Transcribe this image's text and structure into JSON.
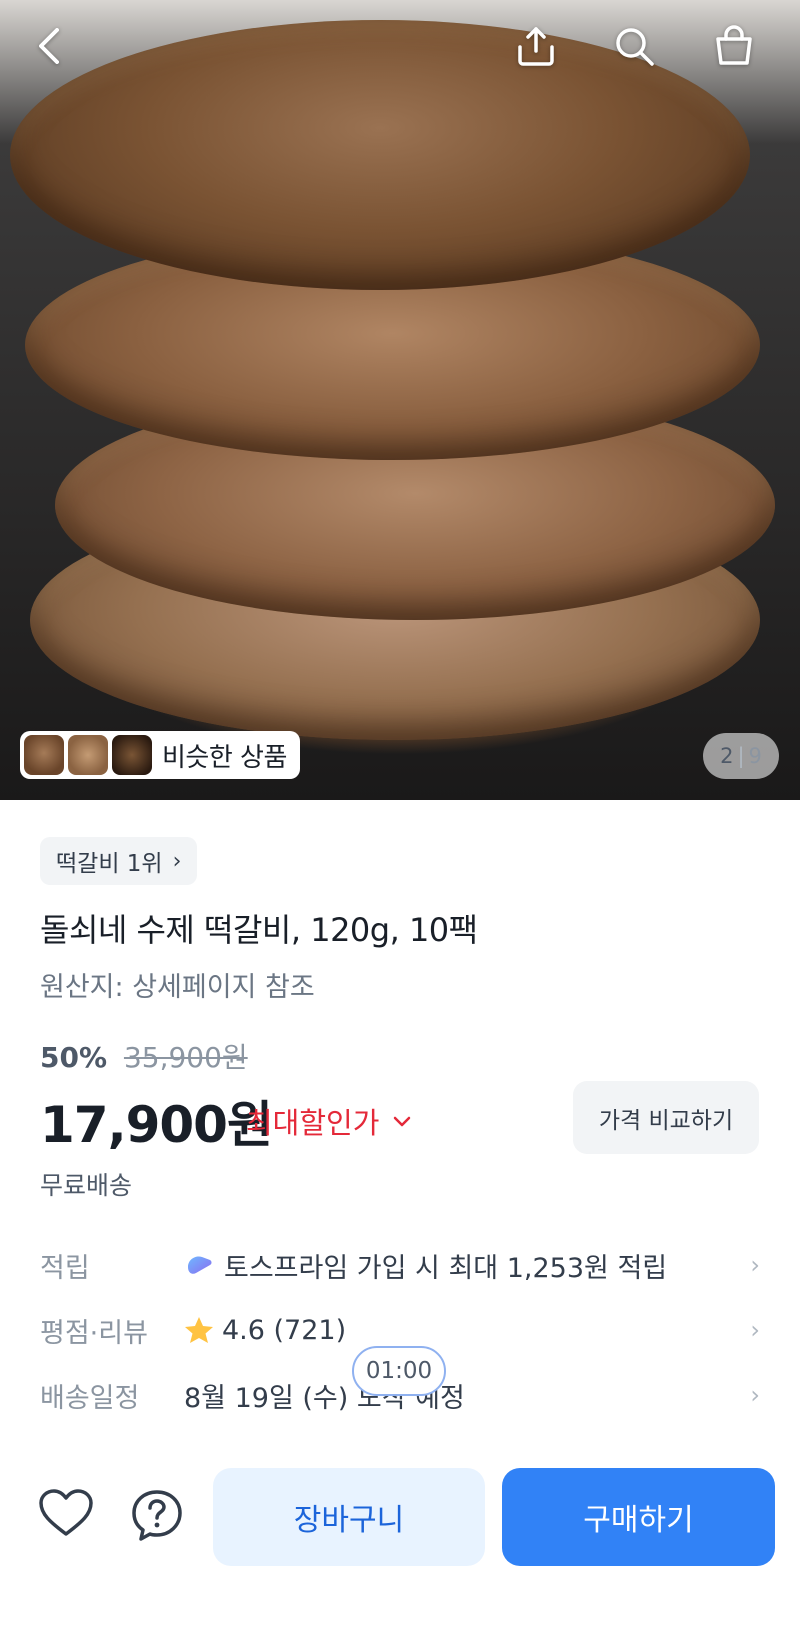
{
  "hero": {
    "counter_current": "2",
    "counter_separator": "|",
    "counter_total": "9",
    "similar_label": "비슷한 상품"
  },
  "topbar": {
    "icons": [
      "back-icon",
      "share-icon",
      "search-icon",
      "shopping-bag-icon"
    ]
  },
  "product": {
    "rank_label": "떡갈비 1위",
    "title": "돌쇠네 수제 떡갈비, 120g, 10팩",
    "origin": "원산지: 상세페이지 참조",
    "discount_rate": "50%",
    "original_price": "35,900원",
    "price": "17,900원",
    "best_discount_label": "최대할인가",
    "compare_button": "가격 비교하기",
    "shipping": "무료배송"
  },
  "info_rows": [
    {
      "key": "적립",
      "value": "토스프라임 가입 시 최대 1,253원 적립"
    },
    {
      "key": "평점·리뷰",
      "value": "4.6 (721)"
    },
    {
      "key": "배송일정",
      "value": "8월 19일 (수) 도착 예정"
    }
  ],
  "timer": "01:00",
  "bottom_bar": {
    "cart_button": "장바구니",
    "buy_button": "구매하기"
  },
  "colors": {
    "primary": "#3182f6",
    "primary_light": "#e8f3ff",
    "discount_red": "#e42939",
    "star": "#ffc342"
  }
}
